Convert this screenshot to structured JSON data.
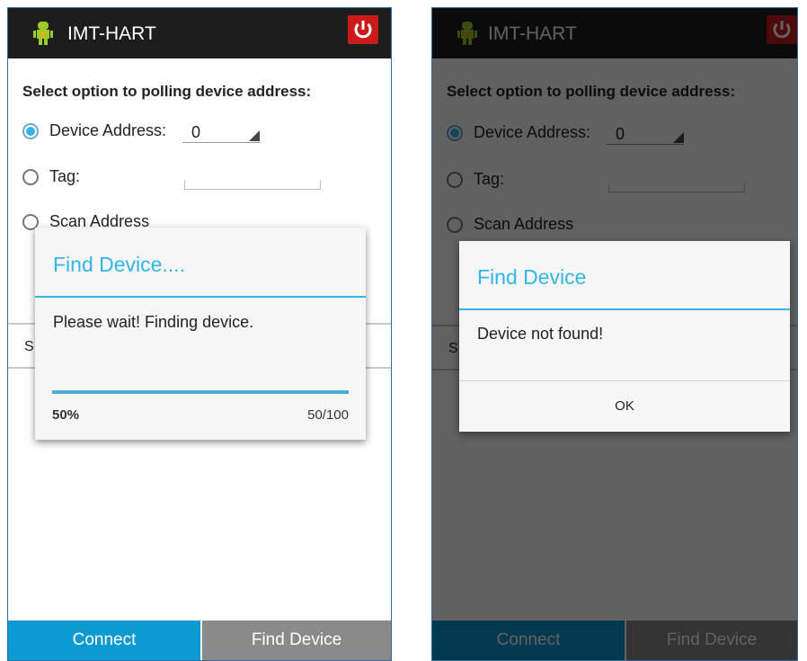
{
  "app": {
    "title": "IMT-HART",
    "icon": "android-robot-icon",
    "power_icon": "power-icon",
    "power_color": "#cc1b1b",
    "actionbar_color": "#1d1d1d"
  },
  "form": {
    "heading": "Select option to polling device address:",
    "device_address_label": "Device Address:",
    "device_address_value": "0",
    "tag_label": "Tag:",
    "tag_value": "",
    "scan_address_label": "Scan Address",
    "selected_option": "device_address",
    "hidden_row_letter": "S"
  },
  "bottom_bar": {
    "connect_label": "Connect",
    "find_device_label": "Find Device",
    "connect_color": "#0d9ad3",
    "find_color": "#8a8a8a"
  },
  "progress_dialog": {
    "title": "Find Device....",
    "message": "Please wait! Finding device.",
    "percent_text": "50%",
    "count_text": "50/100",
    "progress_fraction": 1.0
  },
  "result_dialog": {
    "title": "Find Device",
    "message": "Device not found!",
    "ok_label": "OK"
  },
  "accent_color": "#33b5e5"
}
